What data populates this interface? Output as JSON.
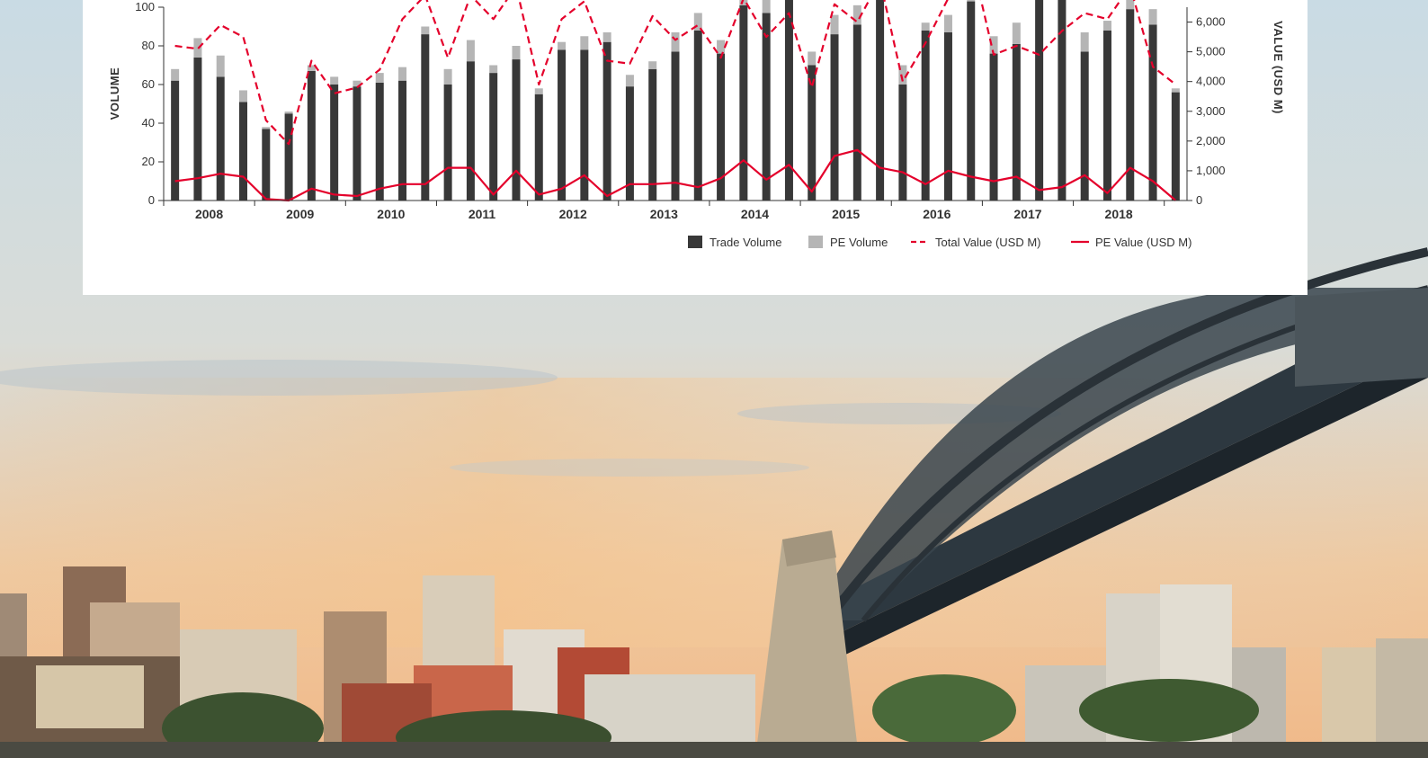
{
  "chart_data": {
    "type": "bar",
    "stacked": true,
    "y_left": {
      "label": "VOLUME",
      "ylim": [
        0,
        100
      ],
      "ticks": [
        "0",
        "20",
        "40",
        "60",
        "80",
        "100"
      ]
    },
    "y_right": {
      "label": "VALUE (USD M)",
      "ylim": [
        0,
        6500
      ],
      "ticks": [
        "0",
        "1,000",
        "2,000",
        "3,000",
        "4,000",
        "5,000",
        "6,000"
      ]
    },
    "x_years": [
      "2008",
      "2009",
      "2010",
      "2011",
      "2012",
      "2013",
      "2014",
      "2015",
      "2016",
      "2017",
      "2018"
    ],
    "quarters_per_year": 4,
    "grid": false,
    "legend_position": "bottom-right",
    "series": [
      {
        "name": "Trade Volume",
        "kind": "bar",
        "axis": "left",
        "color": "#383838",
        "values": [
          62,
          74,
          64,
          51,
          37,
          45,
          67,
          60,
          59,
          61,
          62,
          86,
          60,
          72,
          66,
          73,
          55,
          78,
          78,
          82,
          59,
          68,
          77,
          88,
          76,
          101,
          97,
          110,
          70,
          86,
          91,
          108,
          60,
          88,
          87,
          103,
          76,
          81,
          108,
          108,
          77,
          88,
          99,
          91,
          56
        ]
      },
      {
        "name": "PE Volume",
        "kind": "bar",
        "axis": "left",
        "color": "#b5b5b5",
        "values": [
          6,
          10,
          11,
          6,
          1,
          1,
          3,
          4,
          3,
          5,
          7,
          4,
          8,
          11,
          4,
          7,
          3,
          4,
          7,
          5,
          6,
          4,
          10,
          9,
          7,
          5,
          7,
          4,
          7,
          10,
          10,
          6,
          10,
          4,
          9,
          4,
          9,
          11,
          6,
          6,
          10,
          5,
          9,
          8,
          2
        ]
      },
      {
        "name": "Total Value (USD M)",
        "kind": "line",
        "dashed": true,
        "axis": "right",
        "color": "#e4002b",
        "values": [
          5200,
          5100,
          5900,
          5500,
          2700,
          1900,
          4700,
          3600,
          3800,
          4400,
          6100,
          6900,
          4800,
          6900,
          6100,
          7200,
          3900,
          6100,
          6700,
          4700,
          4600,
          6200,
          5400,
          5900,
          4800,
          6800,
          5500,
          6300,
          3800,
          6600,
          6000,
          7400,
          4000,
          5300,
          6800,
          8200,
          4900,
          5200,
          4900,
          5700,
          6300,
          6100,
          7200,
          4500,
          3900
        ]
      },
      {
        "name": "PE Value (USD M)",
        "kind": "line",
        "dashed": false,
        "axis": "right",
        "color": "#e4002b",
        "values": [
          650,
          750,
          900,
          800,
          50,
          0,
          400,
          200,
          150,
          400,
          550,
          550,
          1100,
          1100,
          200,
          1000,
          200,
          400,
          850,
          150,
          550,
          550,
          600,
          450,
          750,
          1350,
          700,
          1200,
          300,
          1500,
          1700,
          1100,
          950,
          550,
          1000,
          800,
          650,
          800,
          350,
          450,
          850,
          250,
          1100,
          650,
          0
        ]
      }
    ]
  }
}
